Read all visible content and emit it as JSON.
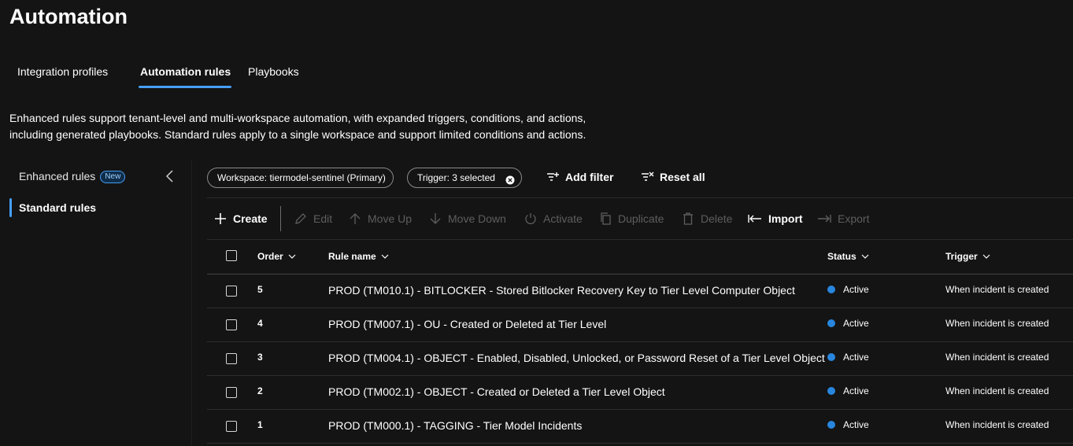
{
  "page": {
    "title": "Automation"
  },
  "tabs": [
    {
      "label": "Integration profiles",
      "active": false
    },
    {
      "label": "Automation rules",
      "active": true
    },
    {
      "label": "Playbooks",
      "active": false
    }
  ],
  "description": {
    "line1": "Enhanced rules support tenant-level and multi-workspace automation, with expanded triggers, conditions, and actions,",
    "line2": "including generated playbooks. Standard rules apply to a single workspace and support limited conditions and actions."
  },
  "left_nav": {
    "items": [
      {
        "label": "Enhanced rules",
        "badge": "New",
        "selected": false
      },
      {
        "label": "Standard rules",
        "selected": true
      }
    ],
    "collapse_icon": "chevron-left-icon"
  },
  "filters": {
    "workspace_pill": "Workspace: tiermodel-sentinel (Primary)",
    "trigger_pill": "Trigger: 3 selected",
    "add_filter": "Add filter",
    "reset_all": "Reset all"
  },
  "toolbar": {
    "create": "Create",
    "edit": "Edit",
    "move_up": "Move Up",
    "move_down": "Move Down",
    "activate": "Activate",
    "duplicate": "Duplicate",
    "delete": "Delete",
    "import": "Import",
    "export": "Export"
  },
  "table": {
    "headers": {
      "order": "Order",
      "rule_name": "Rule name",
      "status": "Status",
      "trigger": "Trigger"
    },
    "rows": [
      {
        "order": "5",
        "name": "PROD (TM010.1) - BITLOCKER - Stored Bitlocker Recovery Key to Tier Level Computer Object",
        "status": "Active",
        "trigger": "When incident is created"
      },
      {
        "order": "4",
        "name": "PROD (TM007.1) - OU - Created or Deleted at Tier Level",
        "status": "Active",
        "trigger": "When incident is created"
      },
      {
        "order": "3",
        "name": "PROD (TM004.1) - OBJECT - Enabled, Disabled, Unlocked, or Password Reset of a Tier Level Object",
        "status": "Active",
        "trigger": "When incident is created"
      },
      {
        "order": "2",
        "name": "PROD (TM002.1) - OBJECT - Created or Deleted a Tier Level Object",
        "status": "Active",
        "trigger": "When incident is created"
      },
      {
        "order": "1",
        "name": "PROD (TM000.1) - TAGGING - Tier Model Incidents",
        "status": "Active",
        "trigger": "When incident is created"
      }
    ]
  },
  "colors": {
    "accent": "#479ef5",
    "status_active": "#2886de",
    "background": "#141414",
    "disabled_text": "#5e5e5e"
  }
}
